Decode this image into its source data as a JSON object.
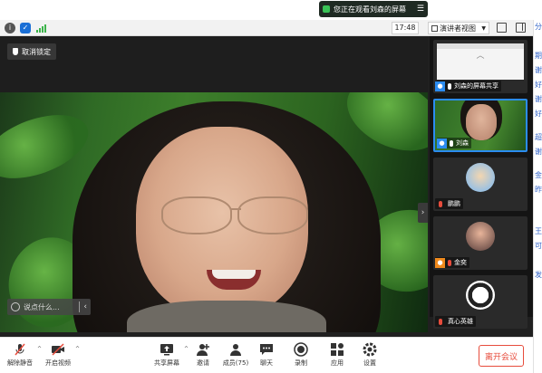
{
  "banner": {
    "text": "您正在观看刘森的屏幕",
    "menu_icon": "menu-icon"
  },
  "titlebar": {
    "time": "17:48",
    "view_mode": "演讲者视图"
  },
  "stage": {
    "unlock_label": "取消锁定",
    "chat_placeholder": "说点什么..."
  },
  "thumbnails": [
    {
      "label": "刘森的屏幕共享",
      "mic": "on",
      "icon": "user"
    },
    {
      "label": "刘森",
      "mic": "on",
      "icon": "user",
      "active": true
    },
    {
      "label": "鹏鹏",
      "mic": "muted",
      "icon": "none"
    },
    {
      "label": "金奕",
      "mic": "muted",
      "icon": "user-orange"
    },
    {
      "label": "真心英雄",
      "mic": "muted",
      "icon": "none"
    }
  ],
  "toolbar": {
    "unmute": "解除静音",
    "start_video": "开启视频",
    "share_screen": "共享屏幕",
    "invite": "邀请",
    "members": "成员(75)",
    "chat": "聊天",
    "record": "录制",
    "apps": "应用",
    "settings": "设置",
    "leave": "离开会议"
  },
  "sliver_chars": [
    "分",
    "期",
    "谢",
    "好",
    "谢",
    "好",
    "超",
    "谢",
    "金",
    "昨",
    "王",
    "可",
    "发"
  ]
}
